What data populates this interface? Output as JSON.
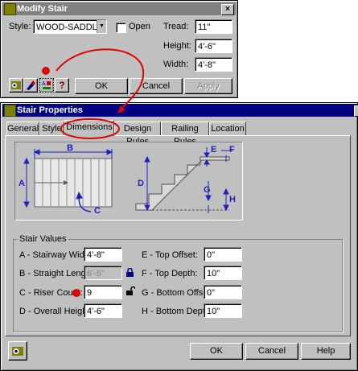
{
  "modify_stair": {
    "title": "Modify Stair",
    "close_glyph": "×",
    "style_label": "Style:",
    "style_value": "WOOD-SADDLE",
    "open_label": "Open",
    "tread_label": "Tread:",
    "tread_value": "11\"",
    "height_label": "Height:",
    "height_value": "4'-6\"",
    "width_label": "Width:",
    "width_value": "4'-8\"",
    "ok_label": "OK",
    "cancel_label": "Cancel",
    "apply_label": "Apply",
    "help_label": "?"
  },
  "stair_properties": {
    "title": "Stair Properties",
    "close_glyph": "×",
    "tabs": [
      {
        "label": "General"
      },
      {
        "label": "Style"
      },
      {
        "label": "Dimensions"
      },
      {
        "label": "Design Rules"
      },
      {
        "label": "Railing Rules"
      },
      {
        "label": "Location"
      }
    ],
    "diagram_labels": {
      "a": "A",
      "b": "B",
      "c": "C",
      "d": "D",
      "e": "E",
      "f": "F",
      "g": "G",
      "h": "H"
    },
    "group_title": "Stair Values",
    "values": {
      "a_label": "A - Stairway Width:",
      "a_value": "4'-8\"",
      "b_label": "B - Straight Length:",
      "b_value": "6'-5\"",
      "c_label": "C - Riser Count:",
      "c_value": "9",
      "d_label": "D - Overall Height:",
      "d_value": "4'-6\"",
      "e_label": "E - Top Offset:",
      "e_value": "0\"",
      "f_label": "F - Top Depth:",
      "f_value": "10\"",
      "g_label": "G - Bottom Offset:",
      "g_value": "0\"",
      "h_label": "H - Bottom Depth:",
      "h_value": "10\""
    },
    "ok_label": "OK",
    "cancel_label": "Cancel",
    "help_label": "Help"
  },
  "colors": {
    "titlebar": "#000080",
    "annotation_red": "#e00000",
    "diagram_blue": "#2020c0"
  }
}
